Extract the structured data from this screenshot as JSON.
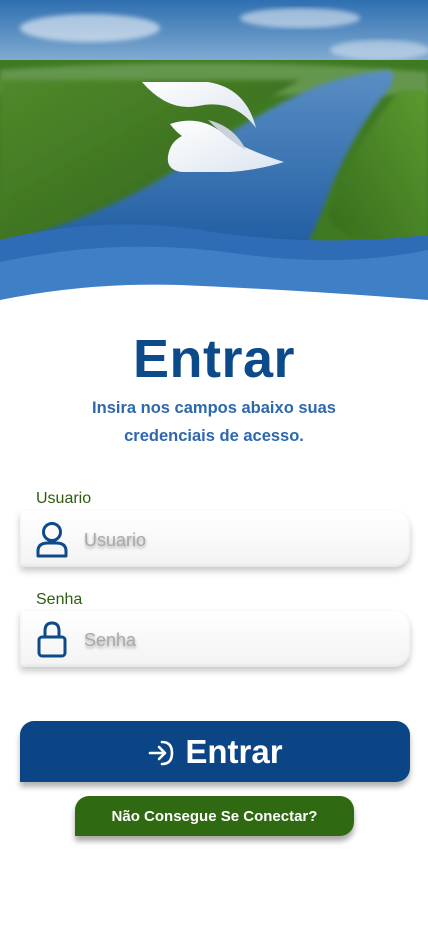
{
  "header": {
    "logo_icon": "bird-wing-logo-icon"
  },
  "title": "Entrar",
  "subtitle": "Insira nos campos abaixo suas credenciais de acesso.",
  "form": {
    "username": {
      "label": "Usuario",
      "placeholder": "Usuario",
      "value": "",
      "icon": "user-icon"
    },
    "password": {
      "label": "Senha",
      "placeholder": "Senha",
      "value": "",
      "icon": "lock-icon"
    }
  },
  "buttons": {
    "login_label": "Entrar",
    "login_icon": "sign-in-arrow-icon",
    "help_label": "Não Consegue Se Conectar?"
  },
  "colors": {
    "primary": "#0b4585",
    "title": "#0d4a8a",
    "subtitle": "#2d68ad",
    "accent_green": "#2f6a13",
    "label_green": "#2f5d0f"
  }
}
